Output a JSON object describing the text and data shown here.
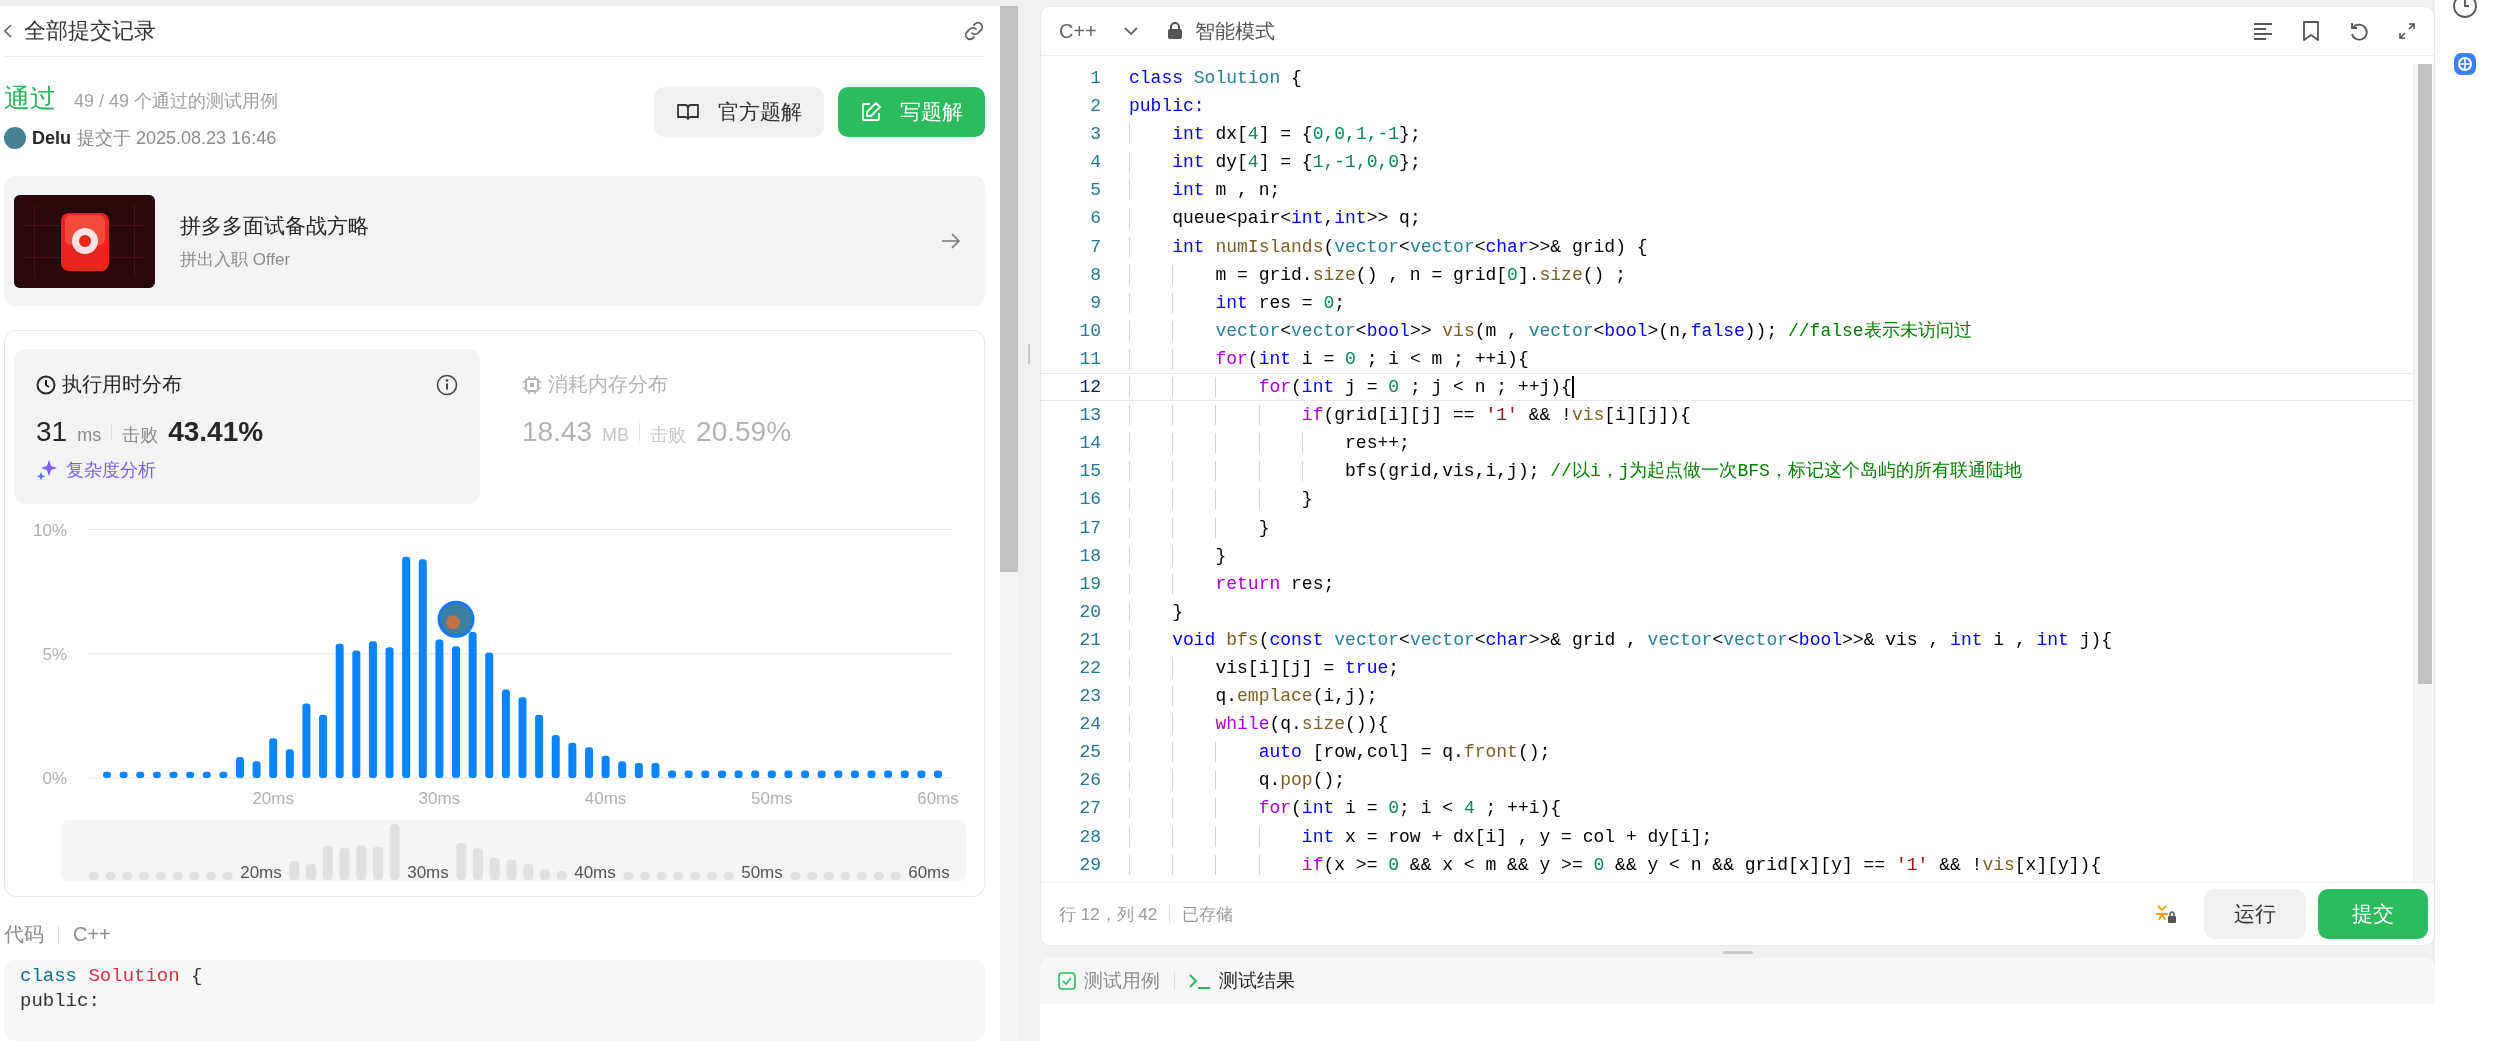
{
  "header": {
    "title": "全部提交记录"
  },
  "submission": {
    "status": "通过",
    "passed": "49 / 49 个通过的测试用例",
    "user": "Delu",
    "submitted": "提交于 2025.08.23 16:46",
    "buttons": [
      {
        "kind": "solution",
        "label": "官方题解"
      },
      {
        "kind": "write",
        "label": "写题解"
      }
    ]
  },
  "promo": {
    "title": "拼多多面试备战方略",
    "subtitle": "拼出入职 Offer"
  },
  "stats": [
    {
      "kind": "runtime",
      "title": "执行用时分布",
      "value": "31",
      "unit": "ms",
      "beats_label": "击败",
      "beats": "43.41%",
      "selected": true,
      "link": "复杂度分析"
    },
    {
      "kind": "memory",
      "title": "消耗内存分布",
      "value": "18.43",
      "unit": "MB",
      "beats_label": "击败",
      "beats": "20.59%",
      "selected": false
    }
  ],
  "chart_data": {
    "type": "bar",
    "x": [
      10,
      11,
      12,
      13,
      14,
      15,
      16,
      17,
      18,
      19,
      20,
      21,
      22,
      23,
      24,
      25,
      26,
      27,
      28,
      29,
      30,
      31,
      32,
      33,
      34,
      35,
      36,
      37,
      38,
      39,
      40,
      41,
      42,
      43,
      44,
      45,
      46,
      47,
      48,
      49,
      50,
      51,
      52,
      53,
      54,
      55,
      56,
      57,
      58,
      59,
      60
    ],
    "series": [
      {
        "color": "#0a84ff",
        "values": [
          0.25,
          0.25,
          0.25,
          0.25,
          0.25,
          0.25,
          0.25,
          0.25,
          0.85,
          0.67,
          1.6,
          1.16,
          3.0,
          2.55,
          5.4,
          5.13,
          5.5,
          5.26,
          8.9,
          8.8,
          5.57,
          5.3,
          5.88,
          5.05,
          3.56,
          3.25,
          2.55,
          1.73,
          1.42,
          1.24,
          0.9,
          0.67,
          0.6,
          0.6,
          0.3,
          0.3,
          0.3,
          0.3,
          0.3,
          0.3,
          0.3,
          0.3,
          0.3,
          0.3,
          0.3,
          0.3,
          0.3,
          0.3,
          0.3,
          0.3,
          0.3
        ]
      }
    ],
    "xlim": [
      10,
      60
    ],
    "ylim": [
      0,
      10
    ],
    "xticks": [
      {
        "value": 20,
        "label": "20ms"
      },
      {
        "value": 30,
        "label": "30ms"
      },
      {
        "value": 40,
        "label": "40ms"
      },
      {
        "value": 50,
        "label": "50ms"
      },
      {
        "value": 60,
        "label": "60ms"
      }
    ],
    "yticks": [
      {
        "value": 0,
        "label": "0%"
      },
      {
        "value": 5,
        "label": "5%"
      },
      {
        "value": 10,
        "label": "10%"
      }
    ]
  },
  "overview": {
    "tick_labels": [
      "20ms",
      "30ms",
      "40ms",
      "50ms",
      "60ms"
    ]
  },
  "code_preview": {
    "label": "代码",
    "language": "C++",
    "lines": [
      [
        {
          "text": "class ",
          "kind": "keyword"
        },
        {
          "text": "Solution",
          "kind": "title"
        },
        {
          "text": " {",
          "kind": "plain"
        }
      ],
      [
        {
          "text": "public:",
          "kind": "plain"
        }
      ]
    ]
  },
  "editor": {
    "language": "C++",
    "mode": "智能模式",
    "lines": [
      {
        "number": "1",
        "current": false,
        "tokens": [
          {
            "text": "class ",
            "kind": "kw"
          },
          {
            "text": "Solution",
            "kind": "type"
          },
          {
            "text": " {",
            "kind": "pl"
          }
        ]
      },
      {
        "number": "2",
        "current": false,
        "tokens": [
          {
            "text": "public:",
            "kind": "kw"
          }
        ]
      },
      {
        "number": "3",
        "current": false,
        "tokens": [
          {
            "text": "    int",
            "kind": "kw"
          },
          {
            "text": " dx[",
            "kind": "pl"
          },
          {
            "text": "4",
            "kind": "num"
          },
          {
            "text": "] = {",
            "kind": "pl"
          },
          {
            "text": "0,0,1,-1",
            "kind": "num"
          },
          {
            "text": "};",
            "kind": "pl"
          }
        ]
      },
      {
        "number": "4",
        "current": false,
        "tokens": [
          {
            "text": "    int",
            "kind": "kw"
          },
          {
            "text": " dy[",
            "kind": "pl"
          },
          {
            "text": "4",
            "kind": "num"
          },
          {
            "text": "] = {",
            "kind": "pl"
          },
          {
            "text": "1,-1,0,0",
            "kind": "num"
          },
          {
            "text": "};",
            "kind": "pl"
          }
        ]
      },
      {
        "number": "5",
        "current": false,
        "tokens": [
          {
            "text": "    int",
            "kind": "kw"
          },
          {
            "text": " m , n;",
            "kind": "pl"
          }
        ]
      },
      {
        "number": "6",
        "current": false,
        "tokens": [
          {
            "text": "    queue<pair<",
            "kind": "pl"
          },
          {
            "text": "int",
            "kind": "kw"
          },
          {
            "text": ",",
            "kind": "pl"
          },
          {
            "text": "int",
            "kind": "kw"
          },
          {
            "text": ">> q;",
            "kind": "pl"
          }
        ]
      },
      {
        "number": "7",
        "current": false,
        "tokens": [
          {
            "text": "    int",
            "kind": "kw"
          },
          {
            "text": " numIslands",
            "kind": "fn"
          },
          {
            "text": "(",
            "kind": "pl"
          },
          {
            "text": "vector",
            "kind": "type"
          },
          {
            "text": "<",
            "kind": "pl"
          },
          {
            "text": "vector",
            "kind": "type"
          },
          {
            "text": "<",
            "kind": "pl"
          },
          {
            "text": "char",
            "kind": "kw"
          },
          {
            "text": ">>& grid) {",
            "kind": "pl"
          }
        ]
      },
      {
        "number": "8",
        "current": false,
        "tokens": [
          {
            "text": "        m = grid.",
            "kind": "pl"
          },
          {
            "text": "size",
            "kind": "fn"
          },
          {
            "text": "() , n = grid[",
            "kind": "pl"
          },
          {
            "text": "0",
            "kind": "num"
          },
          {
            "text": "].",
            "kind": "pl"
          },
          {
            "text": "size",
            "kind": "fn"
          },
          {
            "text": "() ;",
            "kind": "pl"
          }
        ]
      },
      {
        "number": "9",
        "current": false,
        "tokens": [
          {
            "text": "        int",
            "kind": "kw"
          },
          {
            "text": " res = ",
            "kind": "pl"
          },
          {
            "text": "0",
            "kind": "num"
          },
          {
            "text": ";",
            "kind": "pl"
          }
        ]
      },
      {
        "number": "10",
        "current": false,
        "tokens": [
          {
            "text": "        vector",
            "kind": "type"
          },
          {
            "text": "<",
            "kind": "pl"
          },
          {
            "text": "vector",
            "kind": "type"
          },
          {
            "text": "<",
            "kind": "pl"
          },
          {
            "text": "bool",
            "kind": "kw"
          },
          {
            "text": ">> ",
            "kind": "pl"
          },
          {
            "text": "vis",
            "kind": "fn"
          },
          {
            "text": "(m , ",
            "kind": "pl"
          },
          {
            "text": "vector",
            "kind": "type"
          },
          {
            "text": "<",
            "kind": "pl"
          },
          {
            "text": "bool",
            "kind": "kw"
          },
          {
            "text": ">(n,",
            "kind": "pl"
          },
          {
            "text": "false",
            "kind": "kw"
          },
          {
            "text": ")); ",
            "kind": "pl"
          },
          {
            "text": "//false表示未访问过",
            "kind": "cmt"
          }
        ]
      },
      {
        "number": "11",
        "current": false,
        "tokens": [
          {
            "text": "        for",
            "kind": "ctl"
          },
          {
            "text": "(",
            "kind": "pl"
          },
          {
            "text": "int",
            "kind": "kw"
          },
          {
            "text": " i = ",
            "kind": "pl"
          },
          {
            "text": "0",
            "kind": "num"
          },
          {
            "text": " ; i < m ; ++i){",
            "kind": "pl"
          }
        ]
      },
      {
        "number": "12",
        "current": true,
        "tokens": [
          {
            "text": "            for",
            "kind": "ctl"
          },
          {
            "text": "(",
            "kind": "pl"
          },
          {
            "text": "int",
            "kind": "kw"
          },
          {
            "text": " j = ",
            "kind": "pl"
          },
          {
            "text": "0",
            "kind": "num"
          },
          {
            "text": " ; j < n ; ++j){",
            "kind": "pl"
          }
        ]
      },
      {
        "number": "13",
        "current": false,
        "tokens": [
          {
            "text": "                if",
            "kind": "ctl"
          },
          {
            "text": "(grid[i][j] == ",
            "kind": "pl"
          },
          {
            "text": "'1'",
            "kind": "str"
          },
          {
            "text": " && !",
            "kind": "pl"
          },
          {
            "text": "vis",
            "kind": "fn"
          },
          {
            "text": "[i][j]){",
            "kind": "pl"
          }
        ]
      },
      {
        "number": "14",
        "current": false,
        "tokens": [
          {
            "text": "                    res++;",
            "kind": "pl"
          }
        ]
      },
      {
        "number": "15",
        "current": false,
        "tokens": [
          {
            "text": "                    bfs(grid,vis,i,j); ",
            "kind": "pl"
          },
          {
            "text": "//以i，j为起点做一次BFS，标记这个岛屿的所有联通陆地",
            "kind": "cmt"
          }
        ]
      },
      {
        "number": "16",
        "current": false,
        "tokens": [
          {
            "text": "                }",
            "kind": "pl"
          }
        ]
      },
      {
        "number": "17",
        "current": false,
        "tokens": [
          {
            "text": "            }",
            "kind": "pl"
          }
        ]
      },
      {
        "number": "18",
        "current": false,
        "tokens": [
          {
            "text": "        }",
            "kind": "pl"
          }
        ]
      },
      {
        "number": "19",
        "current": false,
        "tokens": [
          {
            "text": "        return",
            "kind": "ctl"
          },
          {
            "text": " res;",
            "kind": "pl"
          }
        ]
      },
      {
        "number": "20",
        "current": false,
        "tokens": [
          {
            "text": "    }",
            "kind": "pl"
          }
        ]
      },
      {
        "number": "21",
        "current": false,
        "tokens": [
          {
            "text": "    void",
            "kind": "kw"
          },
          {
            "text": " bfs",
            "kind": "fn"
          },
          {
            "text": "(",
            "kind": "pl"
          },
          {
            "text": "const",
            "kind": "kw"
          },
          {
            "text": " vector",
            "kind": "type"
          },
          {
            "text": "<",
            "kind": "pl"
          },
          {
            "text": "vector",
            "kind": "type"
          },
          {
            "text": "<",
            "kind": "pl"
          },
          {
            "text": "char",
            "kind": "kw"
          },
          {
            "text": ">>& grid , ",
            "kind": "pl"
          },
          {
            "text": "vector",
            "kind": "type"
          },
          {
            "text": "<",
            "kind": "pl"
          },
          {
            "text": "vector",
            "kind": "type"
          },
          {
            "text": "<",
            "kind": "pl"
          },
          {
            "text": "bool",
            "kind": "kw"
          },
          {
            "text": ">>& vis , ",
            "kind": "pl"
          },
          {
            "text": "int",
            "kind": "kw"
          },
          {
            "text": " i , ",
            "kind": "pl"
          },
          {
            "text": "int",
            "kind": "kw"
          },
          {
            "text": " j){",
            "kind": "pl"
          }
        ]
      },
      {
        "number": "22",
        "current": false,
        "tokens": [
          {
            "text": "        vis[i][j] = ",
            "kind": "pl"
          },
          {
            "text": "true",
            "kind": "kw"
          },
          {
            "text": ";",
            "kind": "pl"
          }
        ]
      },
      {
        "number": "23",
        "current": false,
        "tokens": [
          {
            "text": "        q.",
            "kind": "pl"
          },
          {
            "text": "emplace",
            "kind": "fn"
          },
          {
            "text": "(i,j);",
            "kind": "pl"
          }
        ]
      },
      {
        "number": "24",
        "current": false,
        "tokens": [
          {
            "text": "        while",
            "kind": "ctl"
          },
          {
            "text": "(q.",
            "kind": "pl"
          },
          {
            "text": "size",
            "kind": "fn"
          },
          {
            "text": "()){",
            "kind": "pl"
          }
        ]
      },
      {
        "number": "25",
        "current": false,
        "tokens": [
          {
            "text": "            auto",
            "kind": "kw"
          },
          {
            "text": " [row,col] = q.",
            "kind": "pl"
          },
          {
            "text": "front",
            "kind": "fn"
          },
          {
            "text": "();",
            "kind": "pl"
          }
        ]
      },
      {
        "number": "26",
        "current": false,
        "tokens": [
          {
            "text": "            q.",
            "kind": "pl"
          },
          {
            "text": "pop",
            "kind": "fn"
          },
          {
            "text": "();",
            "kind": "pl"
          }
        ]
      },
      {
        "number": "27",
        "current": false,
        "tokens": [
          {
            "text": "            for",
            "kind": "ctl"
          },
          {
            "text": "(",
            "kind": "pl"
          },
          {
            "text": "int",
            "kind": "kw"
          },
          {
            "text": " i = ",
            "kind": "pl"
          },
          {
            "text": "0",
            "kind": "num"
          },
          {
            "text": "; i < ",
            "kind": "pl"
          },
          {
            "text": "4",
            "kind": "num"
          },
          {
            "text": " ; ++i){",
            "kind": "pl"
          }
        ]
      },
      {
        "number": "28",
        "current": false,
        "tokens": [
          {
            "text": "                int",
            "kind": "kw"
          },
          {
            "text": " x = row + dx[i] , y = col + dy[i];",
            "kind": "pl"
          }
        ]
      },
      {
        "number": "29",
        "current": false,
        "tokens": [
          {
            "text": "                if",
            "kind": "ctl"
          },
          {
            "text": "(x >= ",
            "kind": "pl"
          },
          {
            "text": "0",
            "kind": "num"
          },
          {
            "text": " && x < m && y >= ",
            "kind": "pl"
          },
          {
            "text": "0",
            "kind": "num"
          },
          {
            "text": " && y < n && grid[x][y] == ",
            "kind": "pl"
          },
          {
            "text": "'1'",
            "kind": "str"
          },
          {
            "text": " && !",
            "kind": "pl"
          },
          {
            "text": "vis",
            "kind": "fn"
          },
          {
            "text": "[x][y]){",
            "kind": "pl"
          }
        ]
      }
    ],
    "status": {
      "position": "行 12，列 42",
      "saved": "已存储"
    },
    "buttons": [
      {
        "kind": "run",
        "label": "运行"
      },
      {
        "kind": "submit",
        "label": "提交"
      }
    ]
  },
  "test_panel": {
    "tabs": [
      {
        "kind": "cases",
        "label": "测试用例",
        "selected": false
      },
      {
        "kind": "result",
        "label": "测试结果",
        "selected": true
      }
    ]
  }
}
